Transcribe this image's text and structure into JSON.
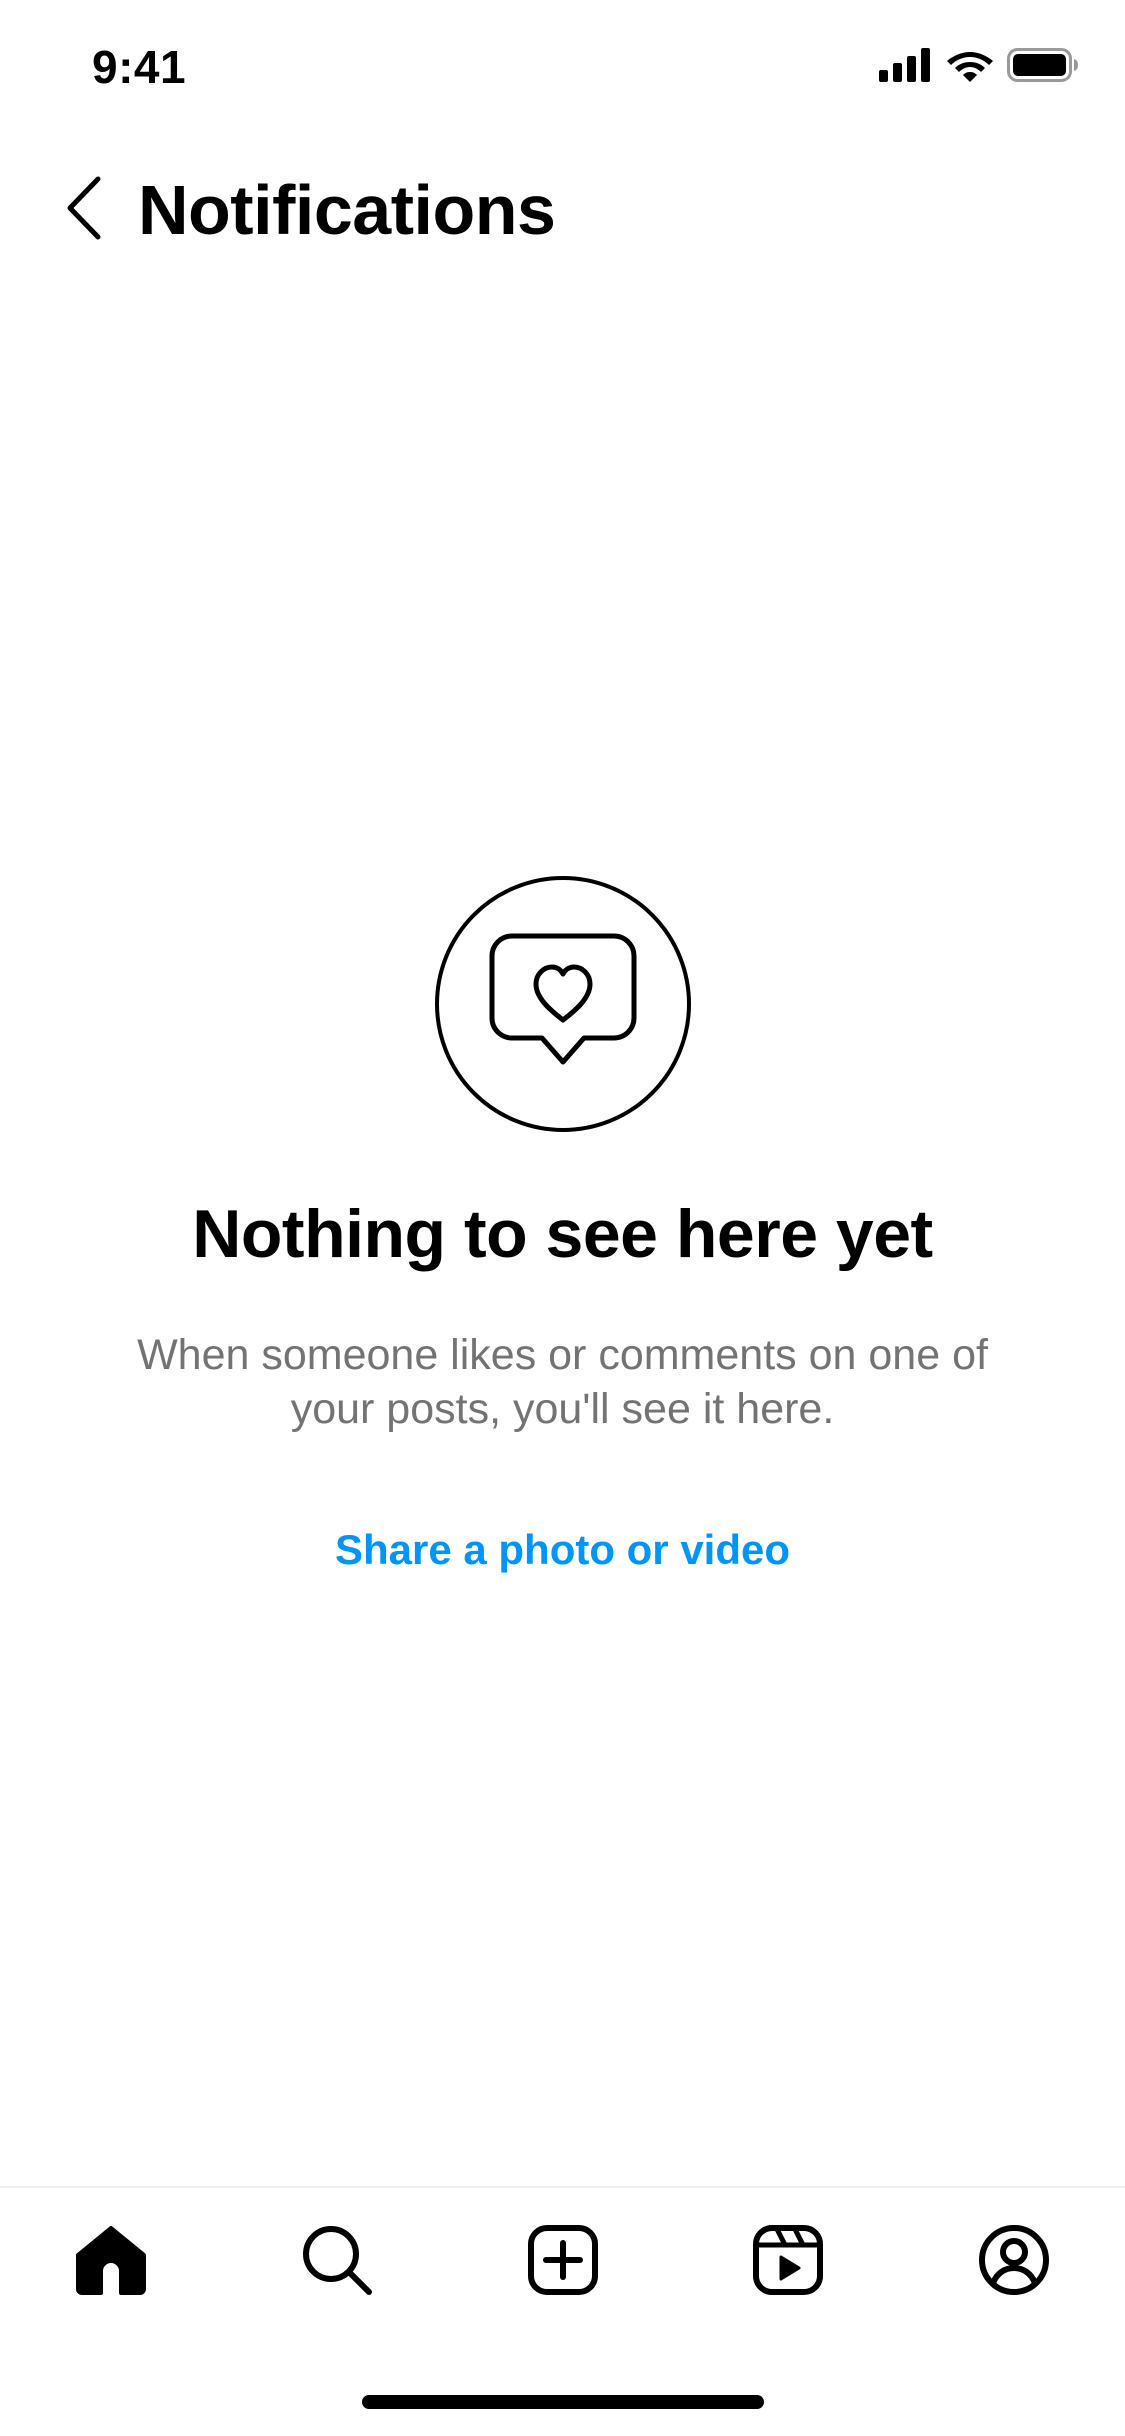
{
  "status_bar": {
    "time": "9:41"
  },
  "header": {
    "title": "Notifications"
  },
  "empty_state": {
    "heading": "Nothing to see here yet",
    "description": "When someone likes or comments on one of your posts, you'll see it here.",
    "action_label": "Share a photo or video"
  },
  "tabs": [
    {
      "icon": "home-icon",
      "active": true
    },
    {
      "icon": "search-icon",
      "active": false
    },
    {
      "icon": "create-post-icon",
      "active": false
    },
    {
      "icon": "reels-icon",
      "active": false
    },
    {
      "icon": "profile-icon",
      "active": false
    }
  ],
  "colors": {
    "link": "#0095f6",
    "secondary_text": "#737373",
    "divider": "#efefef"
  }
}
